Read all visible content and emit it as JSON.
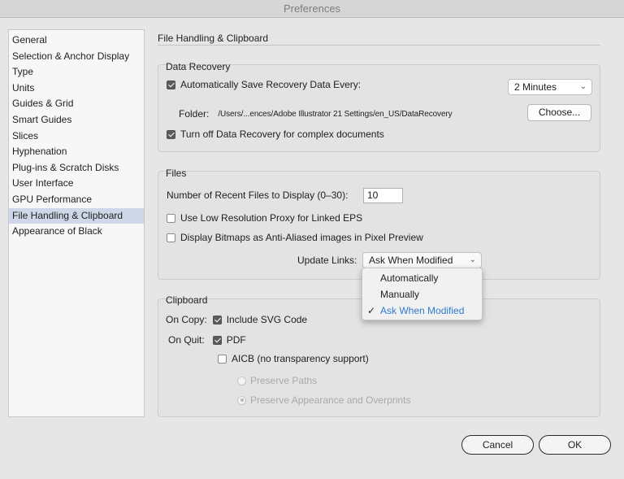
{
  "window": {
    "title": "Preferences"
  },
  "sidebar": {
    "items": [
      {
        "label": "General"
      },
      {
        "label": "Selection & Anchor Display"
      },
      {
        "label": "Type"
      },
      {
        "label": "Units"
      },
      {
        "label": "Guides & Grid"
      },
      {
        "label": "Smart Guides"
      },
      {
        "label": "Slices"
      },
      {
        "label": "Hyphenation"
      },
      {
        "label": "Plug-ins & Scratch Disks"
      },
      {
        "label": "User Interface"
      },
      {
        "label": "GPU Performance"
      },
      {
        "label": "File Handling & Clipboard"
      },
      {
        "label": "Appearance of Black"
      }
    ],
    "selected": "File Handling & Clipboard",
    "selected_bg": "#cfd8e8"
  },
  "panel": {
    "title": "File Handling & Clipboard"
  },
  "data_recovery": {
    "label": "Data Recovery",
    "auto_save_label": "Automatically Save Recovery Data Every:",
    "auto_save_checked": true,
    "interval_value": "2 Minutes",
    "folder_label": "Folder:",
    "folder_path": "/Users/...ences/Adobe Illustrator 21 Settings/en_US/DataRecovery",
    "choose_label": "Choose...",
    "complex_label": "Turn off Data Recovery for complex documents",
    "complex_checked": true
  },
  "files": {
    "label": "Files",
    "recent_label": "Number of Recent Files to Display (0–30):",
    "recent_value": "10",
    "low_res_label": "Use Low Resolution Proxy for Linked EPS",
    "low_res_checked": false,
    "bitmaps_label": "Display Bitmaps as Anti-Aliased images in Pixel Preview",
    "bitmaps_checked": false,
    "update_links_label": "Update Links:",
    "update_links_value": "Ask When Modified"
  },
  "update_links_menu": {
    "options": [
      "Automatically",
      "Manually",
      "Ask When Modified"
    ],
    "selected": "Ask When Modified",
    "selected_color": "#2e7ad1"
  },
  "clipboard": {
    "label": "Clipboard",
    "on_copy_label": "On Copy:",
    "include_svg_label": "Include SVG Code",
    "include_svg_checked": true,
    "on_quit_label": "On Quit:",
    "pdf_label": "PDF",
    "pdf_checked": true,
    "aicb_label": "AICB (no transparency support)",
    "aicb_checked": false,
    "preserve_paths_label": "Preserve Paths",
    "preserve_appearance_label": "Preserve Appearance and Overprints",
    "preserve_selected": "Preserve Appearance and Overprints"
  },
  "footer": {
    "cancel_label": "Cancel",
    "ok_label": "OK"
  }
}
